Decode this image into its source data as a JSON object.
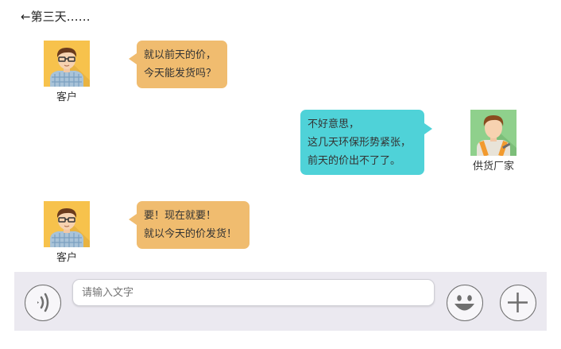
{
  "header": {
    "title": "←第三天……"
  },
  "messages": [
    {
      "sender": "客户",
      "lines": [
        "就以前天的价，",
        "今天能发货吗？"
      ]
    },
    {
      "sender": "供货厂家",
      "lines": [
        "不好意思，",
        "这几天环保形势紧张，",
        "前天的价出不了了。"
      ]
    },
    {
      "sender": "客户",
      "lines": [
        "要！现在就要！",
        "就以今天的价发货！"
      ]
    }
  ],
  "input": {
    "placeholder": "请输入文字"
  },
  "icons": {
    "voice": "voice-icon",
    "emoji": "smiley-icon",
    "plus": "plus-icon"
  },
  "colors": {
    "customer_bubble": "#f0bc6f",
    "supplier_bubble": "#4fd2d8",
    "input_bar": "#ebe9f0"
  }
}
